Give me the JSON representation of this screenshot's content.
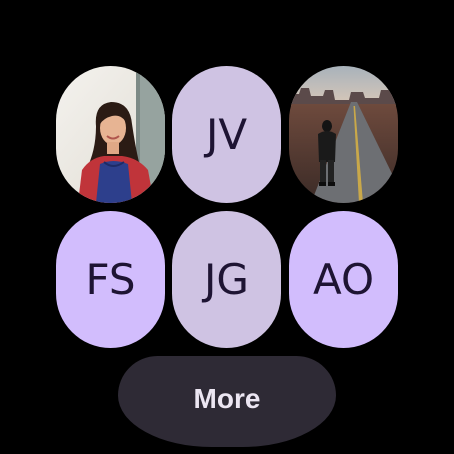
{
  "contacts": [
    {
      "type": "photo",
      "photo": "woman-smiling-portrait"
    },
    {
      "type": "initials",
      "initials": "JV",
      "color": "#cfc3e3"
    },
    {
      "type": "photo",
      "photo": "person-walking-on-desert-road"
    },
    {
      "type": "initials",
      "initials": "FS",
      "color": "#d2bdfd"
    },
    {
      "type": "initials",
      "initials": "JG",
      "color": "#cfc3e3"
    },
    {
      "type": "initials",
      "initials": "AO",
      "color": "#d2bdfd"
    }
  ],
  "more_button": {
    "label": "More",
    "color": "#2e2a35"
  }
}
